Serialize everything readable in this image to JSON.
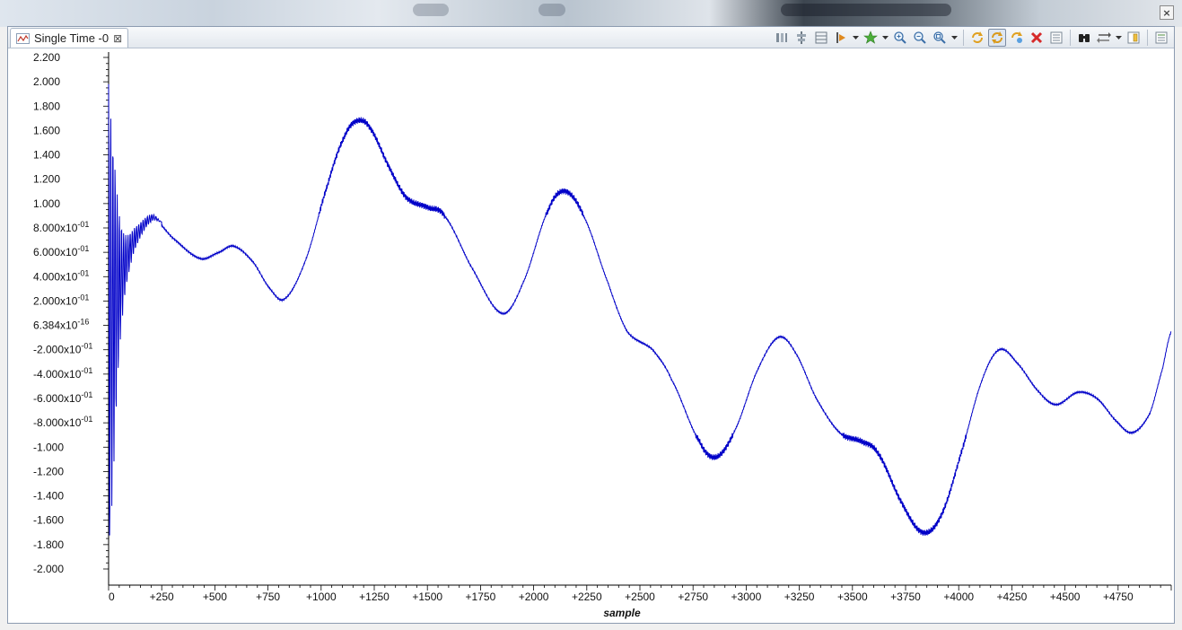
{
  "tab": {
    "title": "Single Time -0"
  },
  "icons": {
    "tab": "time-plot-icon",
    "tab_close": "close-icon",
    "window_close": "window-close-icon",
    "toolbar": [
      "columns-icon",
      "align-center-icon",
      "layout-icon",
      "marker-icon",
      "dropdown-icon",
      "star-add-icon",
      "dropdown-icon",
      "zoom-in-icon",
      "zoom-out-icon",
      "zoom-fit-icon",
      "dropdown-icon",
      "refresh-icon",
      "sync-icon",
      "auto-refresh-icon",
      "delete-icon",
      "list-icon",
      "binoculars-icon",
      "arrows-icon",
      "dropdown-icon",
      "settings-icon",
      "properties-icon"
    ]
  },
  "colors": {
    "series": "#0000c8",
    "frame": "#8c9bb0"
  },
  "chart_data": {
    "type": "line",
    "title": "",
    "xlabel": "sample",
    "ylabel": "",
    "xlim": [
      0,
      5000
    ],
    "ylim": [
      -2.1,
      2.25
    ],
    "grid": false,
    "x_ticks": [
      {
        "v": 0,
        "label": "0"
      },
      {
        "v": 250,
        "label": "+250"
      },
      {
        "v": 500,
        "label": "+500"
      },
      {
        "v": 750,
        "label": "+750"
      },
      {
        "v": 1000,
        "label": "+1000"
      },
      {
        "v": 1250,
        "label": "+1250"
      },
      {
        "v": 1500,
        "label": "+1500"
      },
      {
        "v": 1750,
        "label": "+1750"
      },
      {
        "v": 2000,
        "label": "+2000"
      },
      {
        "v": 2250,
        "label": "+2250"
      },
      {
        "v": 2500,
        "label": "+2500"
      },
      {
        "v": 2750,
        "label": "+2750"
      },
      {
        "v": 3000,
        "label": "+3000"
      },
      {
        "v": 3250,
        "label": "+3250"
      },
      {
        "v": 3500,
        "label": "+3500"
      },
      {
        "v": 3750,
        "label": "+3750"
      },
      {
        "v": 4000,
        "label": "+4000"
      },
      {
        "v": 4250,
        "label": "+4250"
      },
      {
        "v": 4500,
        "label": "+4500"
      },
      {
        "v": 4750,
        "label": "+4750"
      }
    ],
    "y_ticks": [
      {
        "v": 2.2,
        "label": "2.200"
      },
      {
        "v": 2.0,
        "label": "2.000"
      },
      {
        "v": 1.8,
        "label": "1.800"
      },
      {
        "v": 1.6,
        "label": "1.600"
      },
      {
        "v": 1.4,
        "label": "1.400"
      },
      {
        "v": 1.2,
        "label": "1.200"
      },
      {
        "v": 1.0,
        "label": "1.000"
      },
      {
        "v": 0.8,
        "label": "8.000x10",
        "exp": "-01"
      },
      {
        "v": 0.6,
        "label": "6.000x10",
        "exp": "-01"
      },
      {
        "v": 0.4,
        "label": "4.000x10",
        "exp": "-01"
      },
      {
        "v": 0.2,
        "label": "2.000x10",
        "exp": "-01"
      },
      {
        "v": 0.0,
        "label": "6.384x10",
        "exp": "-16"
      },
      {
        "v": -0.2,
        "label": "-2.000x10",
        "exp": "-01"
      },
      {
        "v": -0.4,
        "label": "-4.000x10",
        "exp": "-01"
      },
      {
        "v": -0.6,
        "label": "-6.000x10",
        "exp": "-01"
      },
      {
        "v": -0.8,
        "label": "-8.000x10",
        "exp": "-01"
      },
      {
        "v": -1.0,
        "label": "-1.000"
      },
      {
        "v": -1.2,
        "label": "-1.200"
      },
      {
        "v": -1.4,
        "label": "-1.400"
      },
      {
        "v": -1.6,
        "label": "-1.600"
      },
      {
        "v": -1.8,
        "label": "-1.800"
      },
      {
        "v": -2.0,
        "label": "-2.000"
      }
    ],
    "series": [
      {
        "color": "#0000c8",
        "transient_envelope": [
          [
            0,
            1.95
          ],
          [
            25,
            1.8
          ],
          [
            50,
            1.3
          ],
          [
            80,
            1.0
          ],
          [
            120,
            0.96
          ],
          [
            170,
            0.94
          ],
          [
            230,
            0.85
          ]
        ],
        "transient_baseline": [
          [
            0,
            0.0
          ],
          [
            60,
            0.4
          ],
          [
            120,
            0.7
          ],
          [
            200,
            0.88
          ],
          [
            250,
            0.85
          ]
        ],
        "values": [
          [
            0,
            0.3
          ],
          [
            100,
            0.9
          ],
          [
            200,
            0.9
          ],
          [
            300,
            0.72
          ],
          [
            430,
            0.55
          ],
          [
            520,
            0.6
          ],
          [
            590,
            0.65
          ],
          [
            680,
            0.52
          ],
          [
            760,
            0.3
          ],
          [
            830,
            0.22
          ],
          [
            930,
            0.55
          ],
          [
            1030,
            1.15
          ],
          [
            1110,
            1.55
          ],
          [
            1170,
            1.68
          ],
          [
            1230,
            1.62
          ],
          [
            1320,
            1.3
          ],
          [
            1400,
            1.05
          ],
          [
            1500,
            0.97
          ],
          [
            1580,
            0.9
          ],
          [
            1700,
            0.5
          ],
          [
            1850,
            0.1
          ],
          [
            1950,
            0.35
          ],
          [
            2070,
            0.95
          ],
          [
            2150,
            1.1
          ],
          [
            2240,
            0.88
          ],
          [
            2350,
            0.35
          ],
          [
            2440,
            -0.05
          ],
          [
            2560,
            -0.2
          ],
          [
            2650,
            -0.45
          ],
          [
            2780,
            -0.95
          ],
          [
            2860,
            -1.08
          ],
          [
            2950,
            -0.85
          ],
          [
            3050,
            -0.38
          ],
          [
            3150,
            -0.1
          ],
          [
            3230,
            -0.22
          ],
          [
            3330,
            -0.6
          ],
          [
            3440,
            -0.88
          ],
          [
            3540,
            -0.95
          ],
          [
            3620,
            -1.05
          ],
          [
            3730,
            -1.45
          ],
          [
            3830,
            -1.7
          ],
          [
            3920,
            -1.55
          ],
          [
            4020,
            -1.0
          ],
          [
            4110,
            -0.45
          ],
          [
            4190,
            -0.2
          ],
          [
            4270,
            -0.3
          ],
          [
            4380,
            -0.55
          ],
          [
            4460,
            -0.65
          ],
          [
            4560,
            -0.55
          ],
          [
            4650,
            -0.6
          ],
          [
            4750,
            -0.8
          ],
          [
            4820,
            -0.88
          ],
          [
            4900,
            -0.72
          ],
          [
            4960,
            -0.35
          ],
          [
            5000,
            -0.05
          ]
        ]
      }
    ]
  }
}
